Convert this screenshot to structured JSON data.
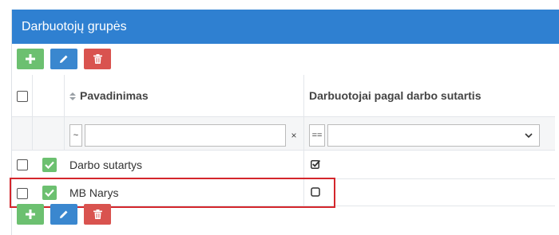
{
  "panel": {
    "title": "Darbuotojų grupės"
  },
  "toolbar": {
    "add": "add-icon",
    "edit": "edit-icon",
    "delete": "delete-icon"
  },
  "table": {
    "columns": {
      "name": "Pavadinimas",
      "by_contract": "Darbuotojai pagal darbo sutartis"
    },
    "filters": {
      "name_operator": "~",
      "name_value": "",
      "name_clear": "×",
      "contract_operator": "==",
      "contract_value": ""
    },
    "rows": [
      {
        "name": "Darbo sutartys",
        "active": true,
        "by_contract": true
      },
      {
        "name": "MB Narys",
        "active": true,
        "by_contract": false
      }
    ]
  },
  "colors": {
    "header": "#2f80d1",
    "add": "#6cc070",
    "edit": "#3a87cf",
    "delete": "#d9534f",
    "highlight": "#d4262c"
  }
}
